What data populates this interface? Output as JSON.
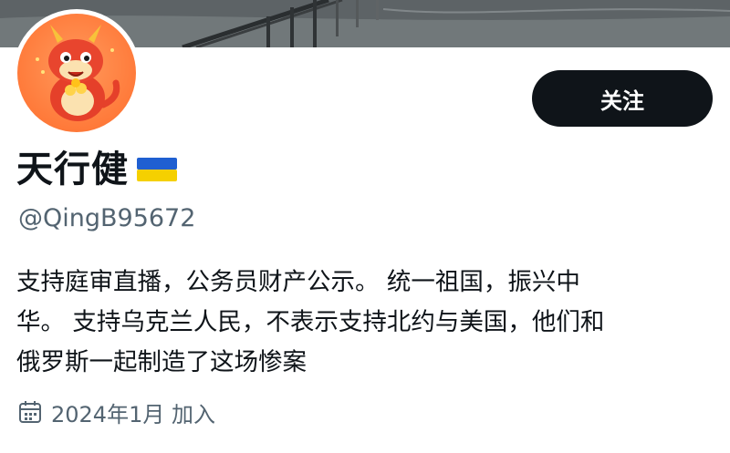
{
  "profile": {
    "display_name": "天行健",
    "flag_icon": "ukraine-flag-icon",
    "handle": "@QingB95672",
    "bio_lines": [
      "支持庭审直播，公务员财产公示。 统一祖国，振兴中",
      "华。 支持乌克兰人民，不表示支持北约与美国，他们和",
      "俄罗斯一起制造了这场惨案"
    ],
    "joined_text": "2024年1月 加入",
    "joined_icon": "calendar-icon"
  },
  "actions": {
    "follow_label": "关注"
  },
  "colors": {
    "follow_bg": "#0f1419",
    "secondary_text": "#536471",
    "flag_blue": "#1f5fd1",
    "flag_yellow": "#f5d000",
    "avatar_bg": "#ff7a3a"
  }
}
